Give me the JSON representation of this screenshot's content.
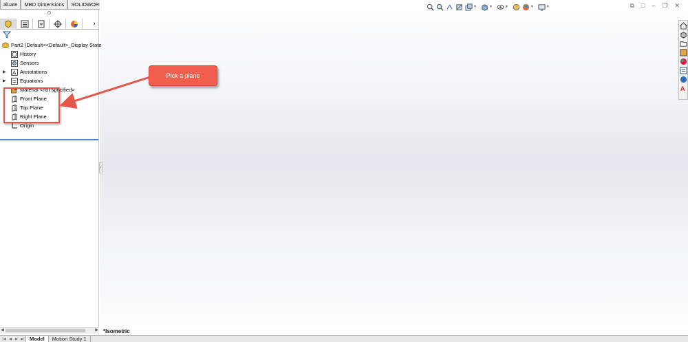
{
  "command_tabs": [
    "aluate",
    "MBD Dimensions",
    "SOLIDWORKS Add-Ins"
  ],
  "feature_tree": {
    "root": "Part2  (Default<<Default>_Display State",
    "items": [
      {
        "label": "History",
        "icon": "history-icon",
        "expandable": false
      },
      {
        "label": "Sensors",
        "icon": "sensors-icon",
        "expandable": false
      },
      {
        "label": "Annotations",
        "icon": "annotations-icon",
        "expandable": true
      },
      {
        "label": "Equations",
        "icon": "equations-icon",
        "expandable": true
      },
      {
        "label": "Material <not specified>",
        "icon": "material-icon",
        "expandable": false
      },
      {
        "label": "Front Plane",
        "icon": "plane-icon",
        "expandable": false
      },
      {
        "label": "Top Plane",
        "icon": "plane-icon",
        "expandable": false
      },
      {
        "label": "Right Plane",
        "icon": "plane-icon",
        "expandable": false
      },
      {
        "label": "Origin",
        "icon": "origin-icon",
        "expandable": false
      }
    ]
  },
  "callout": {
    "text": "Pick a plane",
    "color": "#f25e4e"
  },
  "view": {
    "orientation_label": "*Isometric"
  },
  "bottom_tabs": {
    "model": "Model",
    "motion_study": "Motion Study 1"
  },
  "colors": {
    "accent": "#4a86c9",
    "highlight": "#e4554a"
  }
}
